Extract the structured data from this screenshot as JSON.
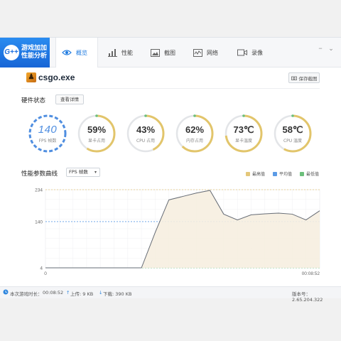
{
  "app": {
    "logo_mark": "G++",
    "logo_line1": "游戏加加",
    "logo_line2": "性能分析"
  },
  "tabs": [
    {
      "label": "概览",
      "icon": "eye-icon",
      "active": true
    },
    {
      "label": "性能",
      "icon": "bar-chart-icon",
      "active": false
    },
    {
      "label": "截图",
      "icon": "image-icon",
      "active": false
    },
    {
      "label": "网络",
      "icon": "network-icon",
      "active": false
    },
    {
      "label": "录像",
      "icon": "video-icon",
      "active": false
    }
  ],
  "window_controls": {
    "minimize": "−",
    "menu": "⌄"
  },
  "game": {
    "name": "csgo.exe",
    "save_label": "保存截图"
  },
  "hardware": {
    "title": "硬件状态",
    "detail_button": "查看详情"
  },
  "gauges": [
    {
      "value": "140",
      "label": "FPS 帧数",
      "color": "#4f8ee0",
      "fill": 1.0
    },
    {
      "value": "59%",
      "label": "显卡占用",
      "color": "#e2c56b",
      "fill": 0.59
    },
    {
      "value": "43%",
      "label": "CPU 占用",
      "color": "#e2c56b",
      "fill": 0.43
    },
    {
      "value": "62%",
      "label": "内存占用",
      "color": "#e2c56b",
      "fill": 0.62
    },
    {
      "value": "73℃",
      "label": "显卡温度",
      "color": "#e2c56b",
      "fill": 0.73
    },
    {
      "value": "58℃",
      "label": "CPU 温度",
      "color": "#e2c56b",
      "fill": 0.58
    }
  ],
  "chart_section": {
    "title": "性能参数曲线",
    "metric_select": "FPS 帧数"
  },
  "legend": [
    {
      "label": "最高值",
      "color": "#e4c77a"
    },
    {
      "label": "平均值",
      "color": "#5b9be6"
    },
    {
      "label": "最低值",
      "color": "#6cbf7b"
    }
  ],
  "chart_data": {
    "type": "line",
    "ylabel": "",
    "xlabel": "",
    "x_tick_labels": [
      "0",
      "00:08:52"
    ],
    "y_ticks": [
      4,
      140,
      234
    ],
    "ylim": [
      4,
      234
    ],
    "x": [
      0,
      0.05,
      0.1,
      0.15,
      0.2,
      0.25,
      0.3,
      0.35,
      0.4,
      0.45,
      0.5,
      0.55,
      0.6,
      0.65,
      0.7,
      0.75,
      0.8,
      0.85,
      0.9,
      0.95,
      1.0
    ],
    "series": [
      {
        "values": [
          4,
          4,
          4,
          4,
          4,
          4,
          4,
          4,
          108,
          204,
          214,
          224,
          232,
          162,
          145,
          160,
          163,
          165,
          162,
          145,
          172
        ]
      }
    ],
    "reference_lines": {
      "max": 234,
      "avg": 140,
      "min": 4
    },
    "grid": true
  },
  "status": {
    "session_label": "本次游戏时长：",
    "session_time": "00:08:52",
    "upload": "上传: 9 KB",
    "download": "下载: 390 KB",
    "version": "版本号：2.65.204.322"
  }
}
